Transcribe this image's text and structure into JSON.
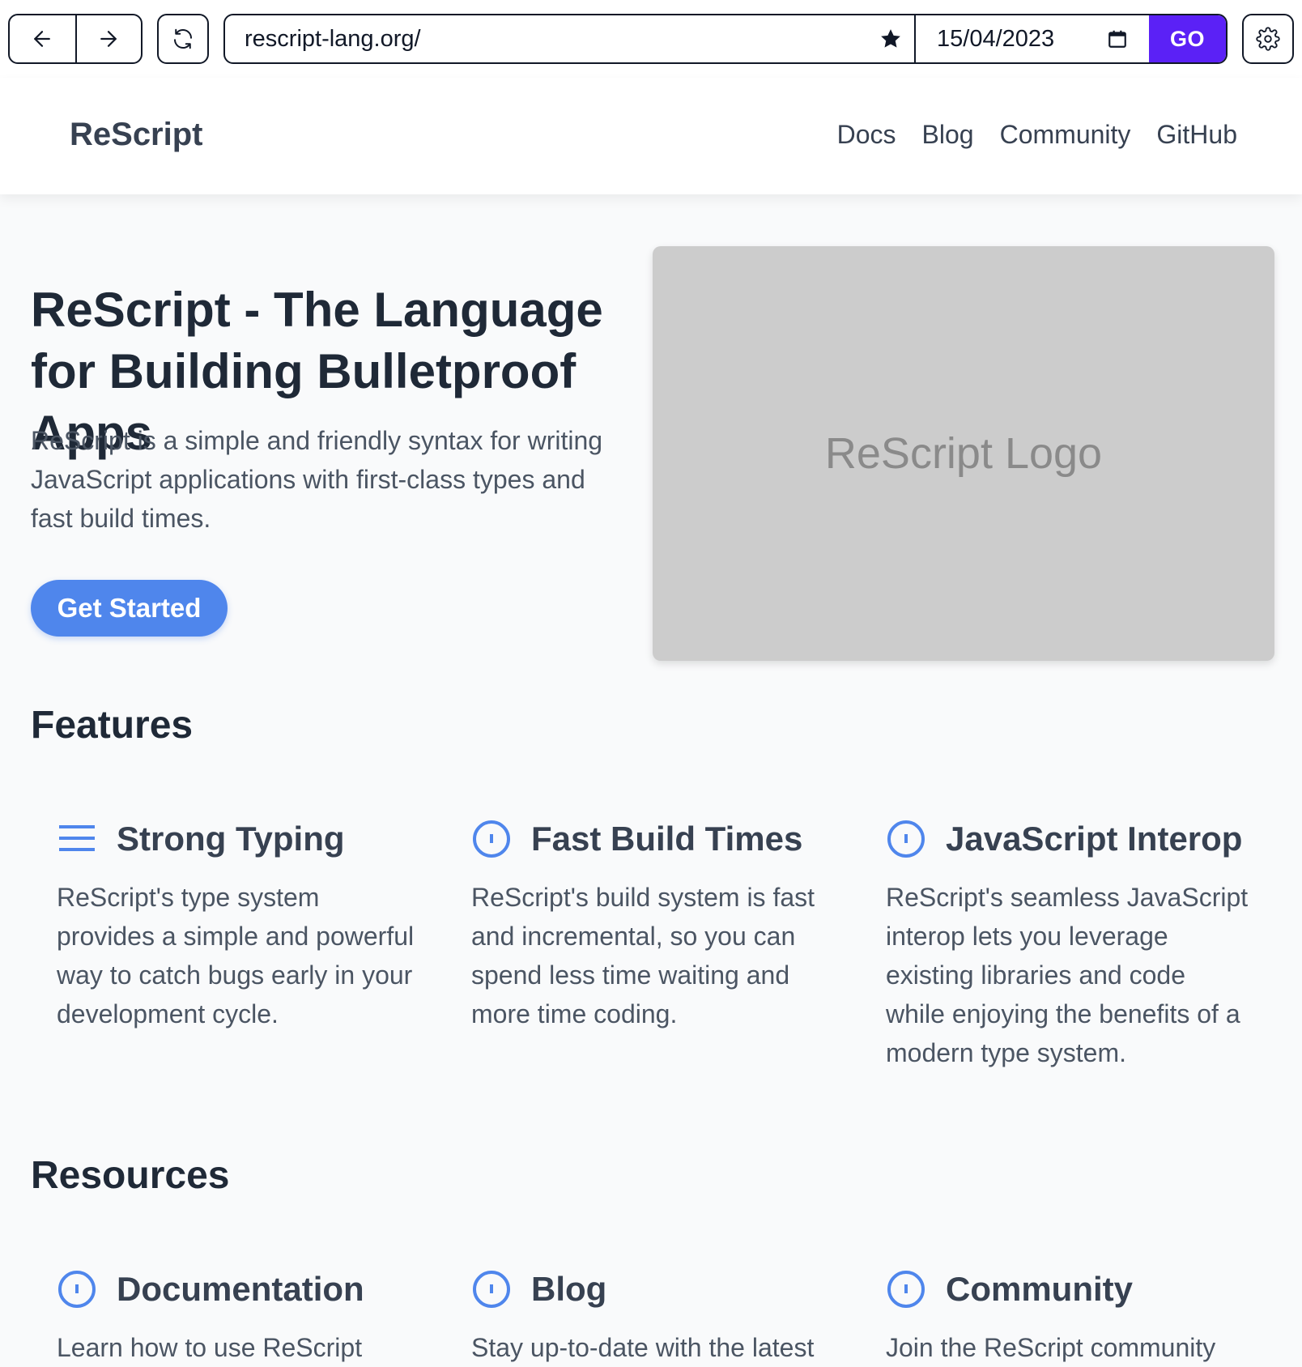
{
  "browser": {
    "url": "rescript-lang.org/",
    "date": "15/04/2023",
    "go_label": "GO"
  },
  "header": {
    "brand": "ReScript",
    "nav": [
      "Docs",
      "Blog",
      "Community",
      "GitHub"
    ]
  },
  "hero": {
    "title": "ReScript - The Language for Building Bulletproof Apps",
    "subtitle": "ReScript is a simple and friendly syntax for writing JavaScript applications with first-class types and fast build times.",
    "cta_label": "Get Started",
    "image_label": "ReScript Logo"
  },
  "features": {
    "title": "Features",
    "items": [
      {
        "title": "Strong Typing",
        "icon": "menu-lines-icon",
        "text": "ReScript's type system provides a simple and powerful way to catch bugs early in your development cycle."
      },
      {
        "title": "Fast Build Times",
        "icon": "circle-info-icon",
        "text": "ReScript's build system is fast and incremental, so you can spend less time waiting and more time coding."
      },
      {
        "title": "JavaScript Interop",
        "icon": "circle-info-icon",
        "text": "ReScript's seamless JavaScript interop lets you leverage existing libraries and code while enjoying the benefits of a modern type system."
      }
    ]
  },
  "resources": {
    "title": "Resources",
    "items": [
      {
        "title": "Documentation",
        "icon": "circle-info-icon",
        "text": "Learn how to use ReScript"
      },
      {
        "title": "Blog",
        "icon": "circle-info-icon",
        "text": "Stay up-to-date with the latest"
      },
      {
        "title": "Community",
        "icon": "circle-info-icon",
        "text": "Join the ReScript community"
      }
    ]
  },
  "colors": {
    "accent": "#4f86ec",
    "go_button": "#5b21f6",
    "text_dark": "#1f2937",
    "text_muted": "#4b5563",
    "placeholder_gray": "#cccccc"
  }
}
